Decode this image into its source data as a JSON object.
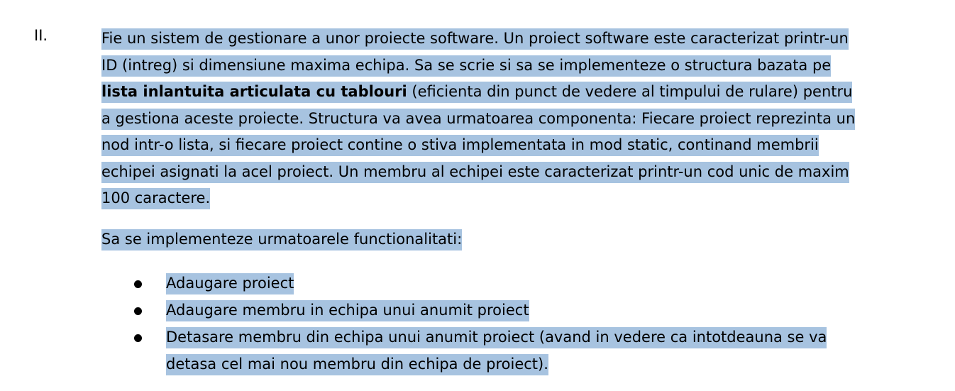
{
  "section_number": "II.",
  "paragraph1": {
    "before_bold": "Fie un sistem de gestionare a unor proiecte software. Un proiect software este caracterizat printr-un ID (intreg) si dimensiune maxima echipa. Sa se scrie si sa se implementeze o structura bazata pe ",
    "bold": "lista inlantuita articulata cu tablouri",
    "after_bold": " (eficienta din punct de vedere al timpului de rulare) pentru a gestiona aceste proiecte. Structura va avea urmatoarea componenta: Fiecare proiect reprezinta un nod intr-o lista, si fiecare proiect contine o stiva implementata in mod static, continand membrii echipei asignati la acel proiect. Un membru al echipei este caracterizat printr-un cod unic de maxim 100 caractere."
  },
  "paragraph2": "Sa se implementeze urmatoarele functionalitati:",
  "functionalities": [
    "Adaugare proiect",
    "Adaugare membru in echipa unui anumit proiect",
    "Detasare membru din echipa unui anumit proiect (avand in vedere ca intotdeauna se va detasa cel mai nou membru din echipa de proiect)."
  ],
  "highlight_color": "#a7c3e0"
}
